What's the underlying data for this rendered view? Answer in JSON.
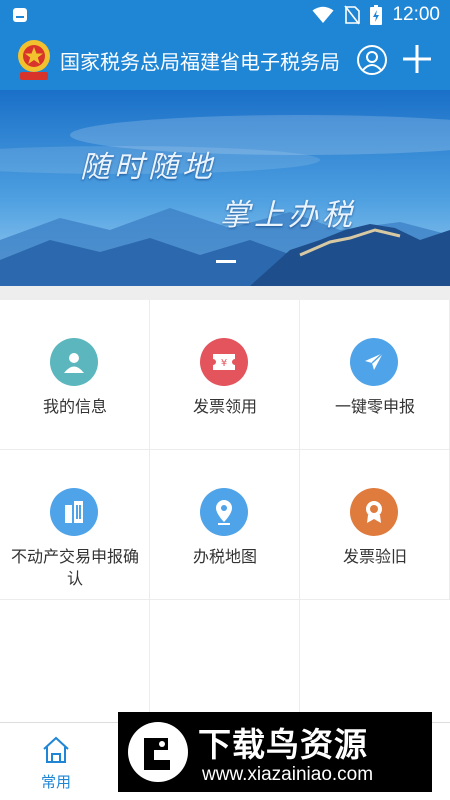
{
  "status_bar": {
    "time": "12:00",
    "icons": [
      "notification-icon",
      "wifi-icon",
      "no-sim-icon",
      "battery-charging-icon"
    ]
  },
  "app_bar": {
    "title": "国家税务总局福建省电子税务局",
    "logo": "tax-emblem-logo",
    "user_icon": "user-icon",
    "add_icon": "plus-icon",
    "background": "#1f86d6"
  },
  "banner": {
    "line1": "随时随地",
    "line2": "掌上办税"
  },
  "services": [
    {
      "label": "我的信息",
      "icon": "person-icon",
      "color": "#5bb7bd"
    },
    {
      "label": "发票领用",
      "icon": "ticket-icon",
      "color": "#e3545d"
    },
    {
      "label": "一键零申报",
      "icon": "paper-plane-icon",
      "color": "#4fa3e8"
    },
    {
      "label": "不动产交易申报确认",
      "icon": "building-icon",
      "color": "#4fa3e8"
    },
    {
      "label": "办税地图",
      "icon": "map-pin-icon",
      "color": "#4fa3e8"
    },
    {
      "label": "发票验旧",
      "icon": "badge-icon",
      "color": "#e07b3e"
    }
  ],
  "tab_bar": {
    "home_label": "常用",
    "active_color": "#1f86d6"
  },
  "watermark": {
    "title": "下载鸟资源",
    "url": "www.xiazainiao.com"
  }
}
